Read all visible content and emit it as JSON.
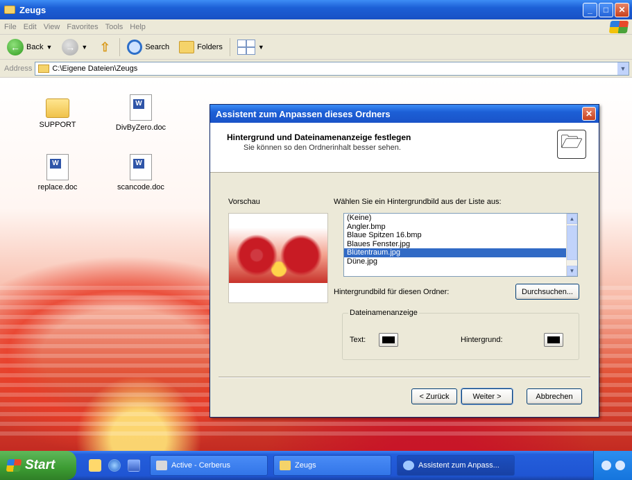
{
  "window": {
    "title": "Zeugs",
    "minimize_glyph": "_",
    "maximize_glyph": "□",
    "close_glyph": "✕"
  },
  "menu": [
    "File",
    "Edit",
    "View",
    "Favorites",
    "Tools",
    "Help"
  ],
  "toolbar": {
    "back_label": "Back",
    "search_label": "Search",
    "folders_label": "Folders"
  },
  "address": {
    "label": "Address",
    "path": "C:\\Eigene Dateien\\Zeugs"
  },
  "files": [
    {
      "name": "SUPPORT",
      "type": "folder"
    },
    {
      "name": "DivByZero.doc",
      "type": "doc"
    },
    {
      "name": "replace.doc",
      "type": "doc"
    },
    {
      "name": "scancode.doc",
      "type": "doc"
    }
  ],
  "dialog": {
    "title": "Assistent zum Anpassen dieses Ordners",
    "close_glyph": "✕",
    "header_title": "Hintergrund und Dateinamenanzeige festlegen",
    "header_subtitle": "Sie können so den Ordnerinhalt besser sehen.",
    "preview_label": "Vorschau",
    "list_label": "Wählen Sie ein Hintergrundbild aus der Liste aus:",
    "list_items": [
      "(Keine)",
      "Angler.bmp",
      "Blaue Spitzen 16.bmp",
      "Blaues Fenster.jpg",
      "Blütentraum.jpg",
      "Düne.jpg"
    ],
    "selected_index": 4,
    "bg_folder_label": "Hintergrundbild für diesen Ordner:",
    "browse_label": "Durchsuchen...",
    "group_title": "Dateinamenanzeige",
    "text_label": "Text:",
    "background_label": "Hintergrund:",
    "text_color": "#000000",
    "background_color": "#000000",
    "back_button": "< Zurück",
    "next_button": "Weiter >",
    "cancel_button": "Abbrechen"
  },
  "taskbar": {
    "start_label": "Start",
    "tasks": [
      "Active - Cerberus",
      "Zeugs",
      "Assistent zum Anpass..."
    ]
  }
}
